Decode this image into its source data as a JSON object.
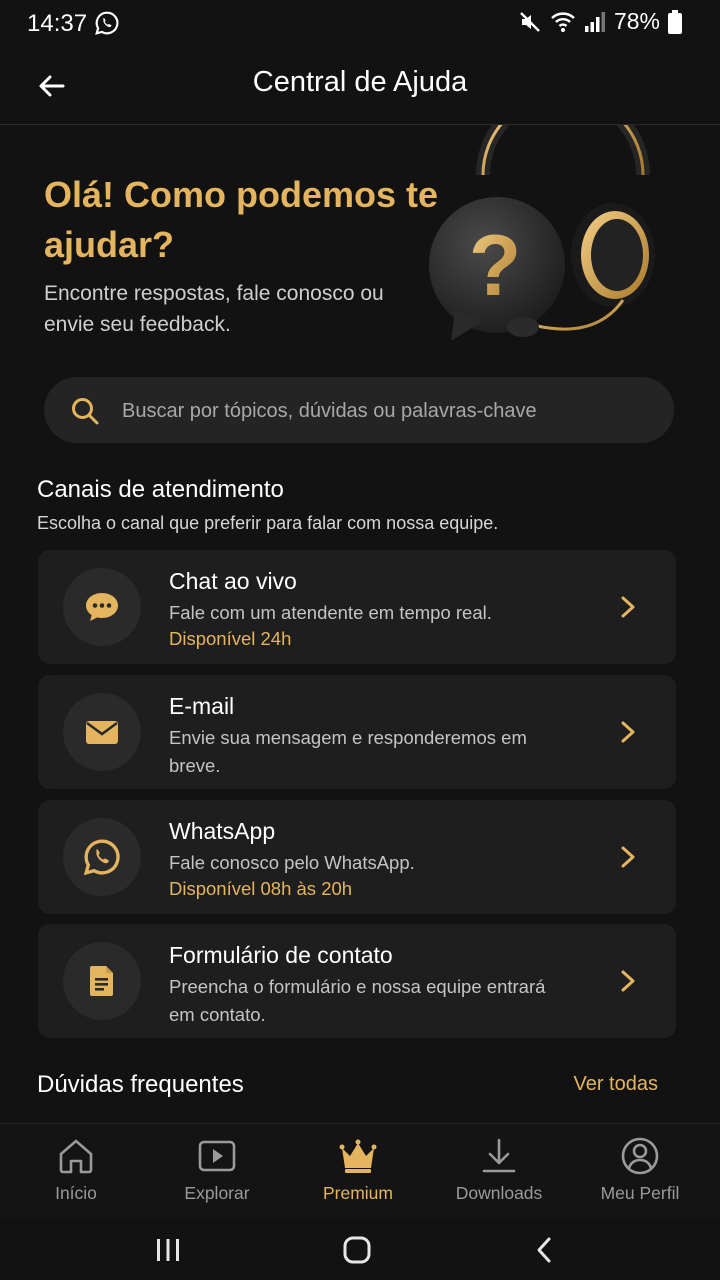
{
  "status_bar": {
    "time": "14:37",
    "battery": "78%",
    "icons": [
      "whatsapp-icon",
      "mute-icon",
      "wifi-icon",
      "signal-icon",
      "battery-icon"
    ]
  },
  "app_bar": {
    "title": "Central de Ajuda",
    "back_icon": "arrow-left-icon"
  },
  "hero": {
    "title": "Olá! Como podemos te ajudar?",
    "subtitle": "Encontre respostas, fale conosco ou envie seu feedback.",
    "illustration": "headset-question-icon"
  },
  "search": {
    "placeholder": "Buscar por tópicos, dúvidas ou palavras-chave",
    "icon": "search-icon"
  },
  "channels_section": {
    "title": "Canais de atendimento",
    "subtitle": "Escolha o canal que preferir para falar com nossa equipe.",
    "items": [
      {
        "title": "Chat ao vivo",
        "description": "Fale com um atendente em tempo real.",
        "availability": "Disponível 24h",
        "icon": "chat-bubble-icon"
      },
      {
        "title": "E-mail",
        "description": "Envie sua mensagem e responderemos em breve.",
        "icon": "envelope-icon"
      },
      {
        "title": "WhatsApp",
        "description": "Fale conosco pelo WhatsApp.",
        "availability": "Disponível 08h às 20h",
        "icon": "whatsapp-icon"
      },
      {
        "title": "Formulário de contato",
        "description": "Preencha o formulário e nossa equipe entrará em contato.",
        "icon": "document-icon"
      }
    ]
  },
  "faq": {
    "title": "Dúvidas frequentes",
    "link": "Ver todas"
  },
  "bottom_nav": {
    "items": [
      {
        "label": "Início",
        "icon": "home-icon"
      },
      {
        "label": "Explorar",
        "icon": "play-icon"
      },
      {
        "label": "Premium",
        "icon": "crown-icon",
        "active": true
      },
      {
        "label": "Downloads",
        "icon": "download-icon"
      },
      {
        "label": "Meu Perfil",
        "icon": "profile-icon"
      }
    ]
  },
  "system_nav": [
    "recents-icon",
    "home-button-icon",
    "back-icon"
  ],
  "colors": {
    "background": "#121212",
    "card": "#1e1e1e",
    "accent": "#E4B45E",
    "text": "#f2f2f2",
    "muted": "#9a9a9a"
  }
}
